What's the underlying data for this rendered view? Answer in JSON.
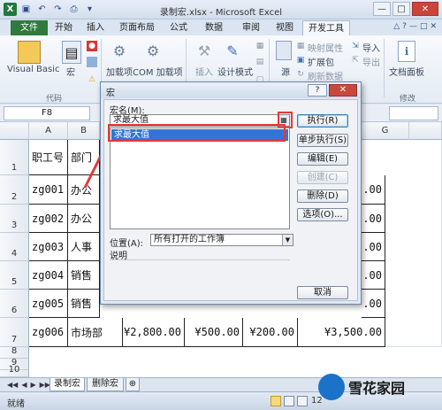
{
  "window": {
    "title": "录制宏.xlsx - Microsoft Excel"
  },
  "ribbon": {
    "tabs": [
      "文件",
      "开始",
      "插入",
      "页面布局",
      "公式",
      "数据",
      "审阅",
      "视图",
      "开发工具"
    ],
    "buttons": {
      "visual_basic": "Visual Basic",
      "macros": "宏",
      "addins": "加载项",
      "com_addins": "COM 加载项",
      "insert": "插入",
      "design_mode": "设计模式",
      "source": "源",
      "map_properties": "映射属性",
      "expansion_packs": "扩展包",
      "refresh_data": "刷新数据",
      "import": "导入",
      "export": "导出",
      "document_panel": "文档面板"
    },
    "groups": {
      "code": "代码",
      "modify": "修改"
    }
  },
  "formula_bar": {
    "name_box": "F8"
  },
  "grid": {
    "columns": [
      "A",
      "B",
      "G"
    ],
    "rows": [
      "1",
      "2",
      "3",
      "4",
      "5",
      "6",
      "7",
      "8",
      "9",
      "10",
      "11"
    ],
    "cells": {
      "a1": "职工号",
      "b1": "部门",
      "a2": "zg001",
      "b2": "办公",
      "a3": "zg002",
      "b3": "办公",
      "a4": "zg003",
      "b4": "人事",
      "a5": "zg004",
      "b5": "销售",
      "a6": "zg005",
      "b6": "销售",
      "a7": "zg006",
      "b7": "市场部",
      "c7": "¥2,800.00",
      "d7": "¥500.00",
      "e7": "¥200.00",
      "f7": "¥3,500.00",
      "f2": ".00",
      "f3": ".00",
      "f4": ".00",
      "f5": ".00",
      "f6": ".00"
    }
  },
  "sheets": {
    "tabs": [
      "录制宏",
      "删除宏"
    ],
    "active": "录制宏"
  },
  "status": {
    "ready": "就绪",
    "zoom": "12"
  },
  "dialog": {
    "title": "宏",
    "help": "?",
    "close": "✕",
    "macro_name_label": "宏名(M):",
    "macro_name_value": "求最大值",
    "macros": [
      "求最大值"
    ],
    "buttons": {
      "run": "执行(R)",
      "step_into": "单步执行(S)",
      "edit": "编辑(E)",
      "create": "创建(C)",
      "delete": "删除(D)",
      "options": "选项(O)...",
      "cancel": "取消"
    },
    "location_label": "位置(A):",
    "location_value": "所有打开的工作簿",
    "description_label": "说明"
  },
  "watermark": {
    "text": "雪花家园"
  },
  "colors": {
    "excel_green": "#2f7a3c",
    "highlight_red": "#e33a3a",
    "selection_blue": "#3375d6"
  }
}
